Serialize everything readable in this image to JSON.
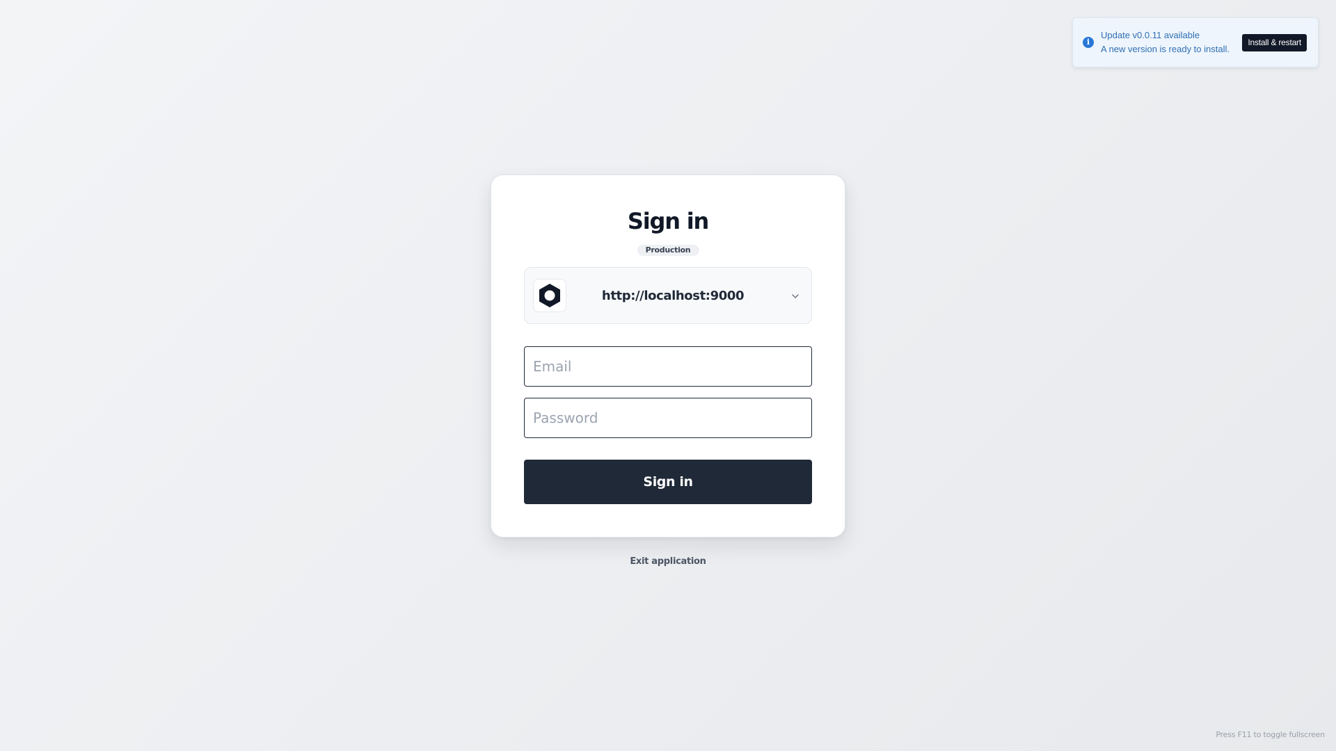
{
  "toast": {
    "icon": "info-icon",
    "title": "Update v0.0.11 available",
    "message": "A new version is ready to install.",
    "action_label": "Install & restart",
    "accent_color": "#2a78d6"
  },
  "login": {
    "title": "Sign in",
    "environment_badge": "Production",
    "server": {
      "logo_icon": "hexagon-logo-icon",
      "url": "http://localhost:9000",
      "dropdown_icon": "chevron-down-icon"
    },
    "email": {
      "value": "",
      "placeholder": "Email"
    },
    "password": {
      "value": "",
      "placeholder": "Password"
    },
    "submit_label": "Sign in",
    "button_color": "#1f2937"
  },
  "exit_label": "Exit application",
  "fullscreen_hint": "Press F11 to toggle fullscreen"
}
